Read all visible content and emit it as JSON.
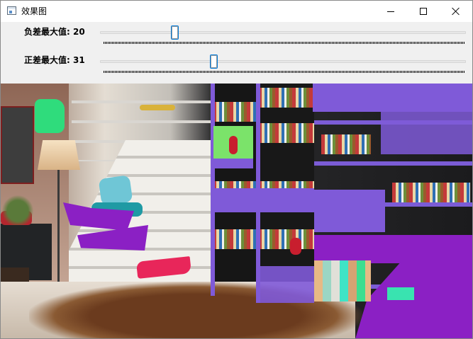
{
  "window": {
    "title": "效果图",
    "icon": "window-app-icon",
    "controls": [
      "minimize-icon",
      "maximize-icon",
      "close-icon"
    ]
  },
  "trackbars": [
    {
      "label": "负差最大值: 20",
      "value": 20,
      "max": 100
    },
    {
      "label": "正差最大值: 31",
      "value": 31,
      "max": 100
    }
  ],
  "colors": {
    "accent_thumb": "#007ad9",
    "overlay_purple": "#8b20c4",
    "overlay_violet": "#7f5ad8",
    "overlay_green": "#2fdc7c",
    "overlay_red": "#e8265a"
  }
}
